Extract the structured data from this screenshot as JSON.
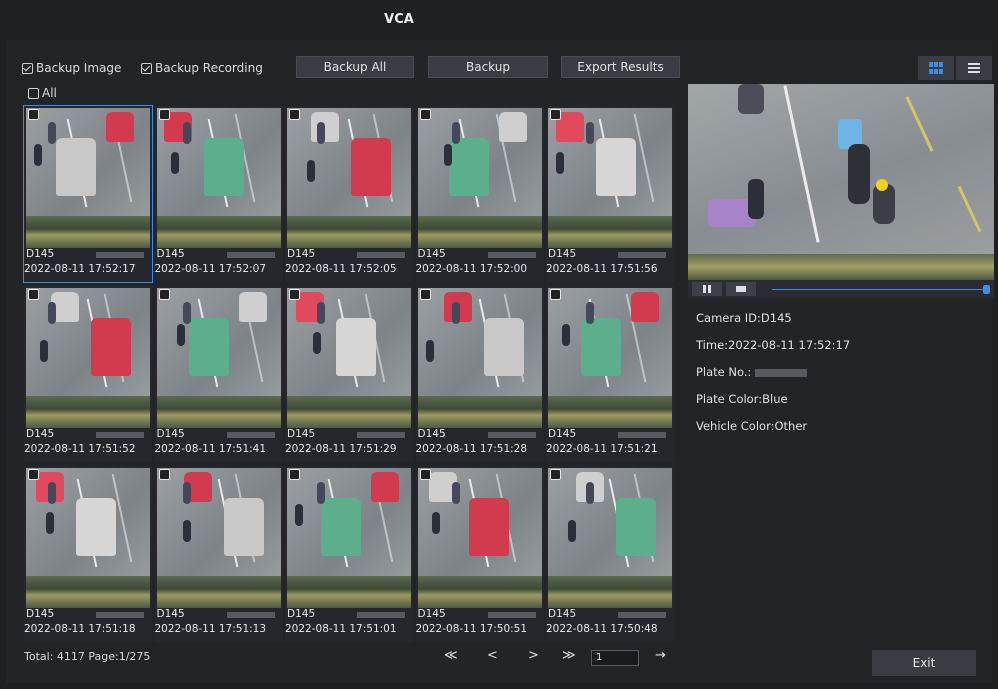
{
  "window": {
    "title": "VCA"
  },
  "toolbar": {
    "backup_image_label": "Backup Image",
    "backup_recording_label": "Backup Recording",
    "backup_all_label": "Backup All",
    "backup_label": "Backup",
    "export_results_label": "Export Results",
    "select_all_label": "All"
  },
  "results": [
    {
      "camera": "D145",
      "time": "2022-08-11 17:52:17"
    },
    {
      "camera": "D145",
      "time": "2022-08-11 17:52:07"
    },
    {
      "camera": "D145",
      "time": "2022-08-11 17:52:05"
    },
    {
      "camera": "D145",
      "time": "2022-08-11 17:52:00"
    },
    {
      "camera": "D145",
      "time": "2022-08-11 17:51:56"
    },
    {
      "camera": "D145",
      "time": "2022-08-11 17:51:52"
    },
    {
      "camera": "D145",
      "time": "2022-08-11 17:51:41"
    },
    {
      "camera": "D145",
      "time": "2022-08-11 17:51:29"
    },
    {
      "camera": "D145",
      "time": "2022-08-11 17:51:28"
    },
    {
      "camera": "D145",
      "time": "2022-08-11 17:51:21"
    },
    {
      "camera": "D145",
      "time": "2022-08-11 17:51:18"
    },
    {
      "camera": "D145",
      "time": "2022-08-11 17:51:13"
    },
    {
      "camera": "D145",
      "time": "2022-08-11 17:51:01"
    },
    {
      "camera": "D145",
      "time": "2022-08-11 17:50:51"
    },
    {
      "camera": "D145",
      "time": "2022-08-11 17:50:48"
    }
  ],
  "footer": {
    "status": "Total: 4117  Page:1/275",
    "first": "≪",
    "prev": "<",
    "next": ">",
    "last": "≫",
    "page_value": "1",
    "go": "→"
  },
  "details": {
    "camera_id": "Camera ID:D145",
    "time": "Time:2022-08-11 17:52:17",
    "plate_no": "Plate No.:",
    "plate_color": "Plate Color:Blue",
    "vehicle_color": "Vehicle Color:Other"
  },
  "exit_label": "Exit",
  "colors": {
    "accent": "#3a8ee6",
    "panel": "#232428"
  }
}
